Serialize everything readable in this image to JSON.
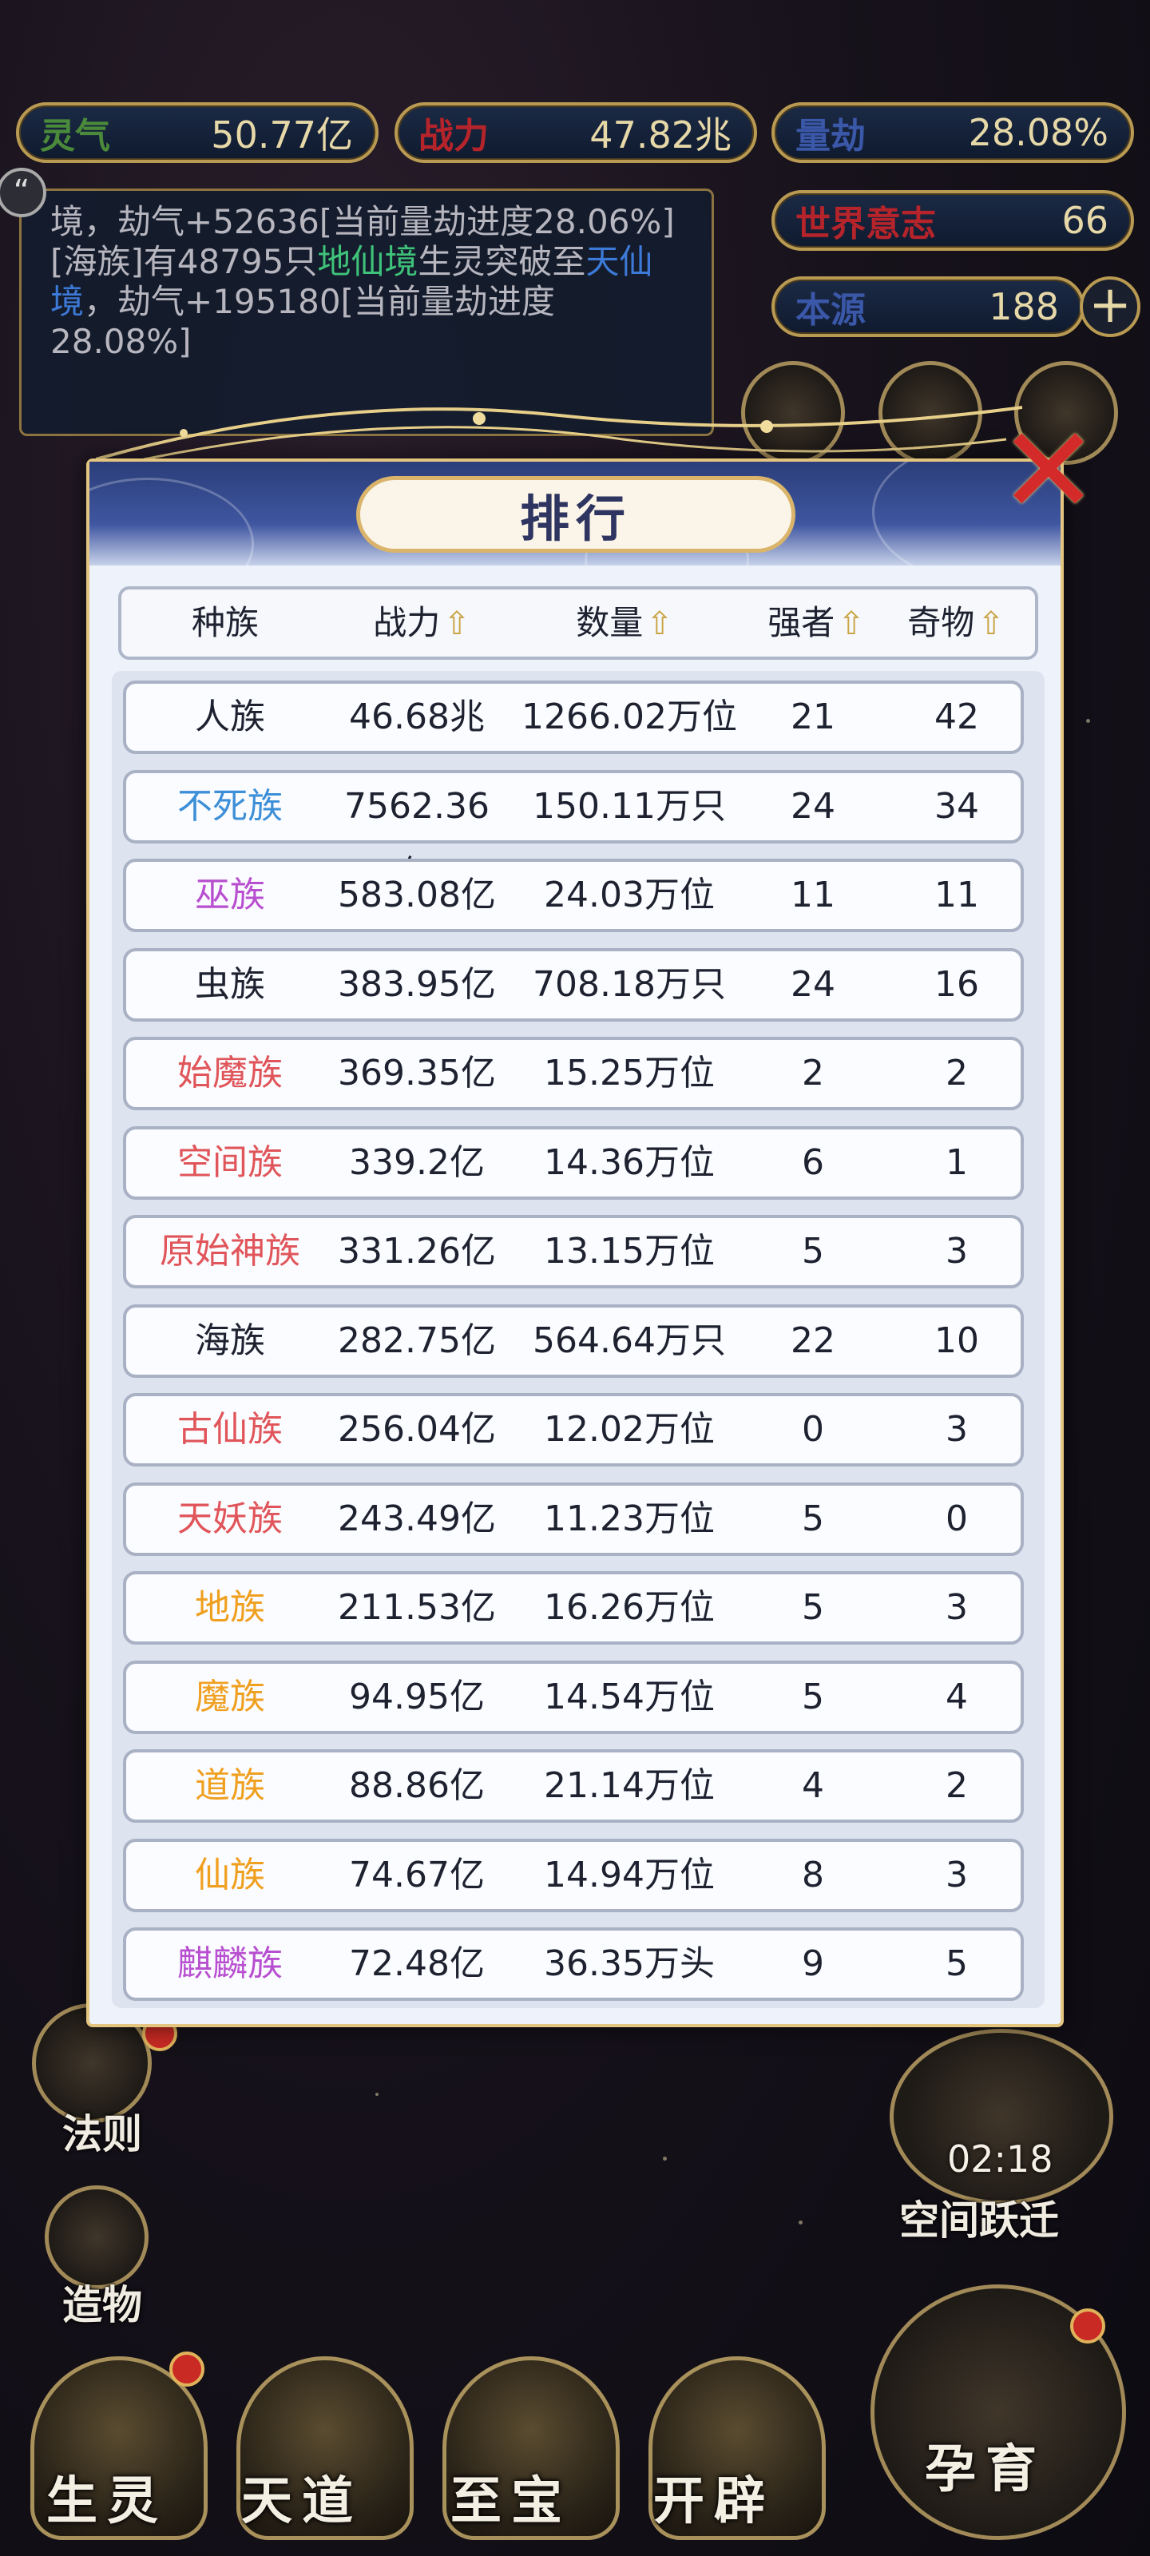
{
  "stats": {
    "lingqi": {
      "label": "灵气",
      "value": "50.77亿",
      "color": "#4a8a3a"
    },
    "zhanli": {
      "label": "战力",
      "value": "47.82兆",
      "color": "#b5242a"
    },
    "liangjie": {
      "label": "量劫",
      "value": "28.08%",
      "color": "#3a57a8"
    },
    "world_will": {
      "label": "世界意志",
      "value": "66",
      "color": "#b5242a"
    },
    "origin": {
      "label": "本源",
      "value": "188",
      "color": "#3a57a8"
    }
  },
  "log": {
    "line1_prefix": "境，劫气+52636[当前量劫进度28.06%]",
    "line2_a": "[海族]有48795只",
    "line2_green": "地仙境",
    "line2_b": "生灵突破至",
    "line2_blue": "天仙境",
    "line2_c": "，劫气+195180[当前量劫进度28.08%]"
  },
  "side_buttons": {
    "fa_ze": "法则",
    "zao_wu": "造物",
    "space_jump": "空间跃迁",
    "timer": "02:18"
  },
  "bottom_nav": [
    "生灵",
    "天道",
    "至宝",
    "开辟",
    "孕育"
  ],
  "modal": {
    "title": "排行",
    "headers": {
      "race": "种族",
      "power": "战力",
      "count": "数量",
      "strong": "强者",
      "relic": "奇物"
    },
    "rows": [
      {
        "name": "人族",
        "color": "#1e2230",
        "power": "46.68兆",
        "count": "1266.02万位",
        "strong": "21",
        "relic": "42"
      },
      {
        "name": "不死族",
        "color": "#3d8fd8",
        "power": "7562.36亿",
        "count": "150.11万只",
        "strong": "24",
        "relic": "34"
      },
      {
        "name": "巫族",
        "color": "#b84fd0",
        "power": "583.08亿",
        "count": "24.03万位",
        "strong": "11",
        "relic": "11"
      },
      {
        "name": "虫族",
        "color": "#1e2230",
        "power": "383.95亿",
        "count": "708.18万只",
        "strong": "24",
        "relic": "16"
      },
      {
        "name": "始魔族",
        "color": "#e0555a",
        "power": "369.35亿",
        "count": "15.25万位",
        "strong": "2",
        "relic": "2"
      },
      {
        "name": "空间族",
        "color": "#e0555a",
        "power": "339.2亿",
        "count": "14.36万位",
        "strong": "6",
        "relic": "1"
      },
      {
        "name": "原始神族",
        "color": "#e0555a",
        "power": "331.26亿",
        "count": "13.15万位",
        "strong": "5",
        "relic": "3"
      },
      {
        "name": "海族",
        "color": "#1e2230",
        "power": "282.75亿",
        "count": "564.64万只",
        "strong": "22",
        "relic": "10"
      },
      {
        "name": "古仙族",
        "color": "#e0555a",
        "power": "256.04亿",
        "count": "12.02万位",
        "strong": "0",
        "relic": "3"
      },
      {
        "name": "天妖族",
        "color": "#e0555a",
        "power": "243.49亿",
        "count": "11.23万位",
        "strong": "5",
        "relic": "0"
      },
      {
        "name": "地族",
        "color": "#f0a020",
        "power": "211.53亿",
        "count": "16.26万位",
        "strong": "5",
        "relic": "3"
      },
      {
        "name": "魔族",
        "color": "#f0a020",
        "power": "94.95亿",
        "count": "14.54万位",
        "strong": "5",
        "relic": "4"
      },
      {
        "name": "道族",
        "color": "#f0a020",
        "power": "88.86亿",
        "count": "21.14万位",
        "strong": "4",
        "relic": "2"
      },
      {
        "name": "仙族",
        "color": "#f0a020",
        "power": "74.67亿",
        "count": "14.94万位",
        "strong": "8",
        "relic": "3"
      },
      {
        "name": "麒麟族",
        "color": "#b84fd0",
        "power": "72.48亿",
        "count": "36.35万头",
        "strong": "9",
        "relic": "5"
      }
    ]
  }
}
